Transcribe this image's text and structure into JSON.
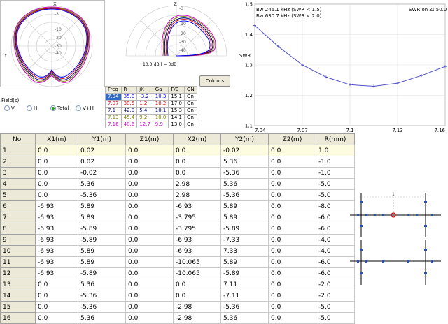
{
  "polar_left": {
    "ticks": [
      "-3",
      "-10",
      "-20",
      "-30",
      "-40"
    ],
    "axis_y": "Y",
    "axis_x": "X"
  },
  "polar_right": {
    "ticks": [
      "-3",
      "-10",
      "-20",
      "-30",
      "-40"
    ],
    "axis_z": "Z",
    "ref_label": "10.3(dBi) = 0dB"
  },
  "colours_button": "Colours",
  "swr_chart": {
    "bw1": "Bw 246.1 kHz (SWR < 1.5)",
    "bw2": "Bw 630.7 kHz (SWR < 2.0)",
    "z_label": "SWR on Z: 50.0",
    "ylabel": "SWR",
    "yticks": [
      "1.5",
      "1.4",
      "1.3",
      "1.2",
      "1.1"
    ],
    "xticks": [
      "7.04",
      "7.07",
      "7.1",
      "7.13",
      "7.16"
    ]
  },
  "chart_data": {
    "type": "line",
    "title": "",
    "xlabel": "",
    "ylabel": "SWR",
    "xlim": [
      7.04,
      7.16
    ],
    "ylim": [
      1.1,
      1.5
    ],
    "grid": true,
    "series": [
      {
        "x": [
          7.04,
          7.055,
          7.07,
          7.085,
          7.1,
          7.115,
          7.13,
          7.145,
          7.16
        ],
        "values": [
          1.43,
          1.36,
          1.3,
          1.26,
          1.235,
          1.23,
          1.24,
          1.265,
          1.295
        ]
      }
    ]
  },
  "freq_table": {
    "headers": [
      "Freq",
      "R",
      "jX",
      "Ga",
      "F/B",
      "ON"
    ],
    "rows": [
      {
        "cells": [
          "7.04",
          "35.0",
          "-3.2",
          "10.3",
          "15.1",
          "On"
        ],
        "color": "#0000ff"
      },
      {
        "cells": [
          "7.07",
          "38.5",
          "1.2",
          "10.2",
          "17.0",
          "On"
        ],
        "color": "#cc0000"
      },
      {
        "cells": [
          "7.1",
          "42.0",
          "5.4",
          "10.1",
          "15.3",
          "On"
        ],
        "color": "#000080"
      },
      {
        "cells": [
          "7.13",
          "45.4",
          "9.2",
          "10.0",
          "14.1",
          "On"
        ],
        "color": "#808000"
      },
      {
        "cells": [
          "7.16",
          "48.6",
          "12.7",
          "9.9",
          "13.0",
          "On"
        ],
        "color": "#cc00cc"
      }
    ]
  },
  "field_group": {
    "title": "Field(s)",
    "options": [
      {
        "label": "V",
        "selected": false
      },
      {
        "label": "H",
        "selected": false
      },
      {
        "label": "Total",
        "selected": true
      },
      {
        "label": "V+H",
        "selected": false
      }
    ]
  },
  "wire_table": {
    "headers": [
      "No.",
      "X1(m)",
      "Y1(m)",
      "Z1(m)",
      "X2(m)",
      "Y2(m)",
      "Z2(m)",
      "R(mm)"
    ],
    "rows": [
      [
        "1",
        "0.0",
        "0.02",
        "0.0",
        "0.0",
        "-0.02",
        "0.0",
        "1.0"
      ],
      [
        "2",
        "0.0",
        "0.02",
        "0.0",
        "0.0",
        "5.36",
        "0.0",
        "-1.0"
      ],
      [
        "3",
        "0.0",
        "-0.02",
        "0.0",
        "0.0",
        "-5.36",
        "0.0",
        "-1.0"
      ],
      [
        "4",
        "0.0",
        "5.36",
        "0.0",
        "2.98",
        "5.36",
        "0.0",
        "-5.0"
      ],
      [
        "5",
        "0.0",
        "-5.36",
        "0.0",
        "2.98",
        "-5.36",
        "0.0",
        "-5.0"
      ],
      [
        "6",
        "-6.93",
        "5.89",
        "0.0",
        "-6.93",
        "5.89",
        "0.0",
        "-8.0"
      ],
      [
        "7",
        "-6.93",
        "5.89",
        "0.0",
        "-3.795",
        "5.89",
        "0.0",
        "-6.0"
      ],
      [
        "8",
        "-6.93",
        "-5.89",
        "0.0",
        "-3.795",
        "-5.89",
        "0.0",
        "-6.0"
      ],
      [
        "9",
        "-6.93",
        "-5.89",
        "0.0",
        "-6.93",
        "-7.33",
        "0.0",
        "-4.0"
      ],
      [
        "10",
        "-6.93",
        "5.89",
        "0.0",
        "-6.93",
        "7.33",
        "0.0",
        "-4.0"
      ],
      [
        "11",
        "-6.93",
        "5.89",
        "0.0",
        "-10.065",
        "5.89",
        "0.0",
        "-6.0"
      ],
      [
        "12",
        "-6.93",
        "-5.89",
        "0.0",
        "-10.065",
        "-5.89",
        "0.0",
        "-6.0"
      ],
      [
        "13",
        "0.0",
        "5.36",
        "0.0",
        "0.0",
        "7.11",
        "0.0",
        "-2.0"
      ],
      [
        "14",
        "0.0",
        "-5.36",
        "0.0",
        "0.0",
        "-7.11",
        "0.0",
        "-2.0"
      ],
      [
        "15",
        "0.0",
        "-5.36",
        "0.0",
        "-2.98",
        "-5.36",
        "0.0",
        "-5.0"
      ],
      [
        "16",
        "0.0",
        "5.36",
        "0.0",
        "-2.98",
        "5.36",
        "0.0",
        "-5.0"
      ]
    ]
  },
  "antenna_view": {
    "feed_label": "1"
  }
}
